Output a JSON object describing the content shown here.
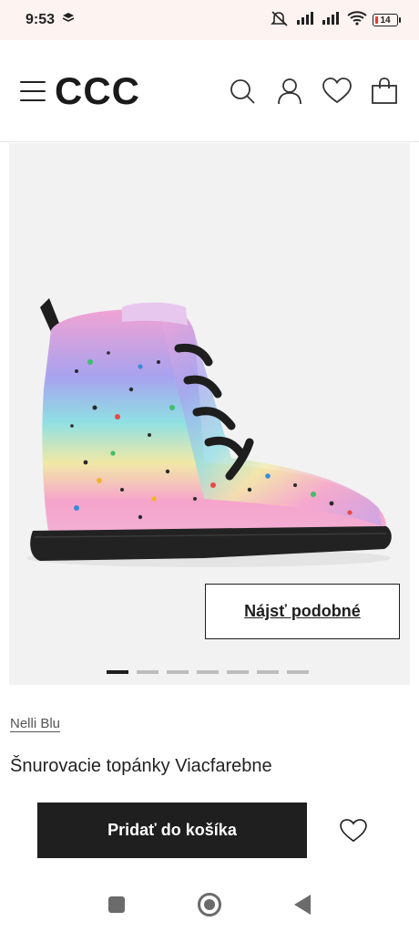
{
  "status_bar": {
    "time": "9:53",
    "battery": "14"
  },
  "header": {
    "logo": "CCC"
  },
  "gallery": {
    "find_similar_label": "Nájsť podobné",
    "image_count": 7,
    "active_index": 0
  },
  "product": {
    "brand": "Nelli Blu",
    "title": "Šnurovacie topánky Viacfarebne"
  },
  "actions": {
    "add_to_cart_label": "Pridať do košíka"
  },
  "colors": {
    "primary": "#1f1f1f",
    "status_bar_bg": "#fdf3f0",
    "gallery_bg": "#f2f2f2"
  }
}
